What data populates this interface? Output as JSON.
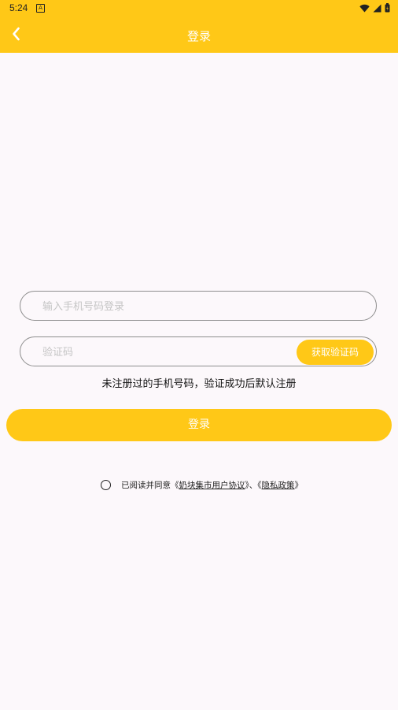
{
  "status_bar": {
    "time": "5:24",
    "app_icon_letter": "A",
    "icons": [
      "wifi-icon",
      "signal-icon",
      "battery-icon"
    ]
  },
  "header": {
    "title": "登录",
    "back_icon": "chevron-left-icon",
    "background_color": "#ffc817"
  },
  "form": {
    "phone_placeholder": "输入手机号码登录",
    "code_placeholder": "验证码",
    "get_code_label": "获取验证码",
    "hint": "未注册过的手机号码，验证成功后默认注册",
    "login_label": "登录"
  },
  "agreement": {
    "prefix": "已阅读并同意《",
    "user_agreement": "奶块集市用户协议",
    "separator": "》、《",
    "privacy_policy": "隐私政策",
    "suffix": "》",
    "checked": false
  }
}
